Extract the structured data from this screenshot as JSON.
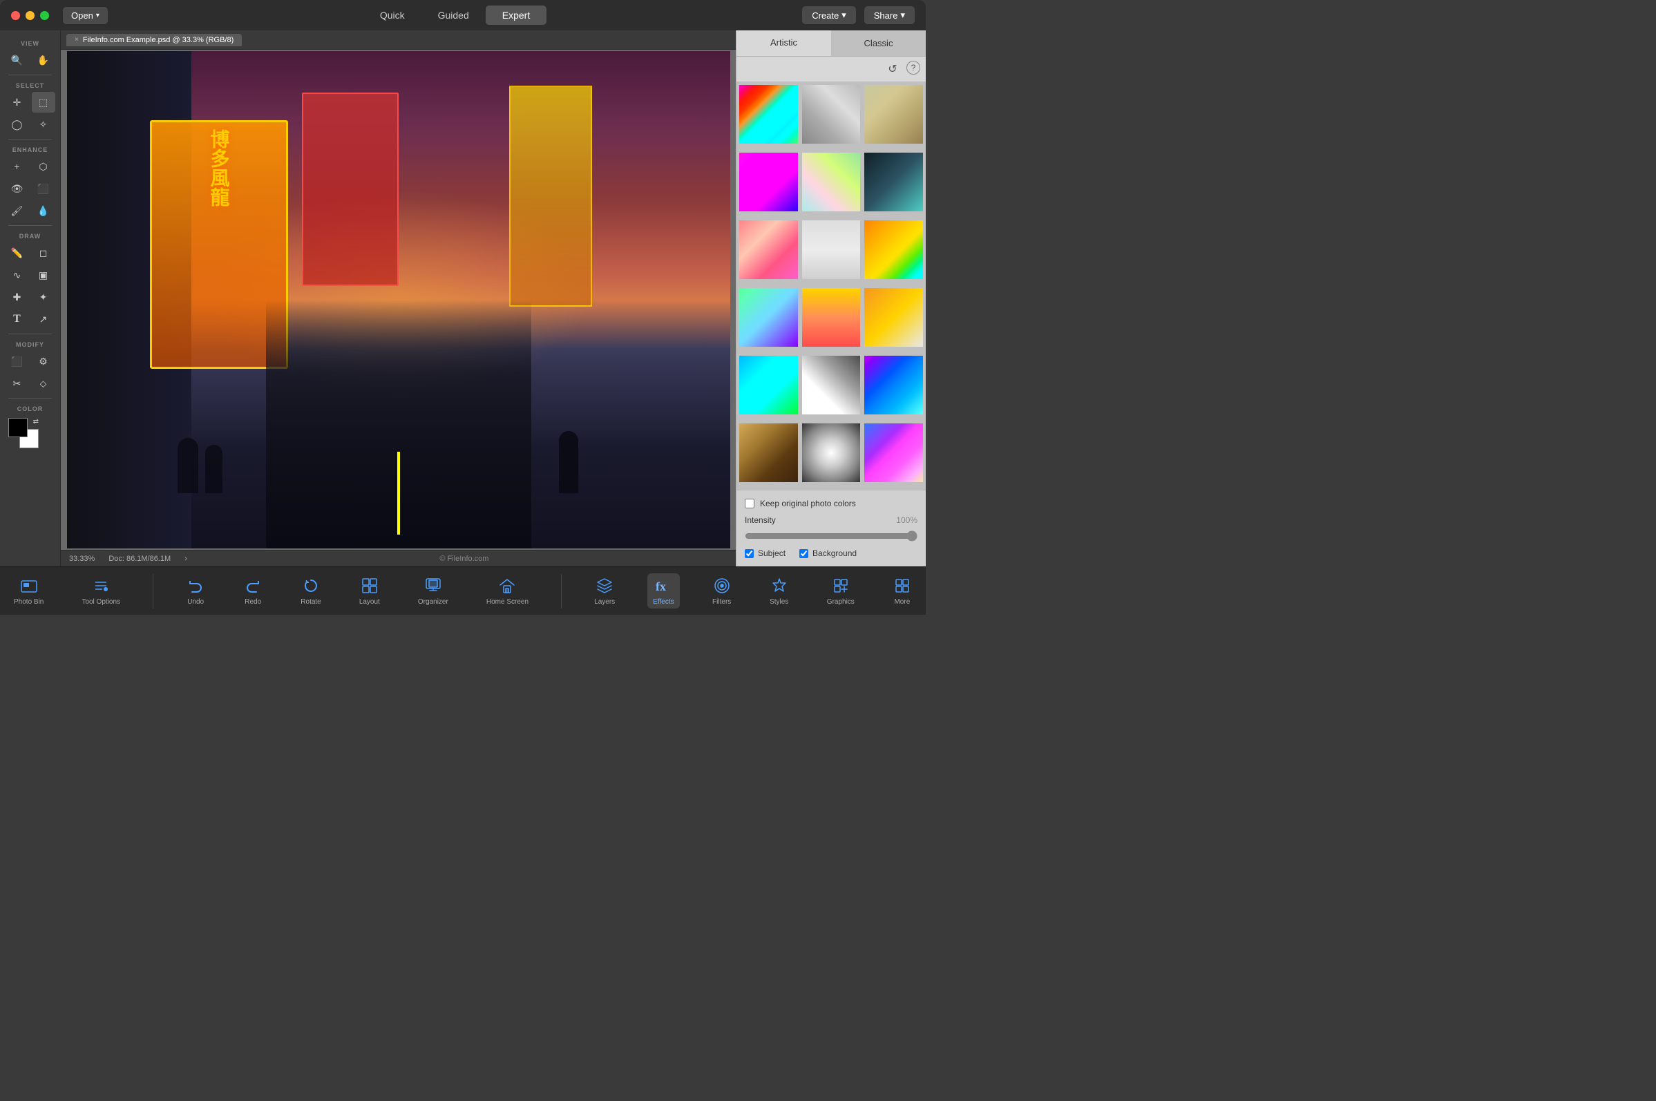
{
  "titlebar": {
    "mode_buttons": [
      {
        "id": "quick",
        "label": "Quick",
        "active": false
      },
      {
        "id": "guided",
        "label": "Guided",
        "active": false
      },
      {
        "id": "expert",
        "label": "Expert",
        "active": true
      }
    ],
    "open_label": "Open",
    "create_label": "Create",
    "share_label": "Share"
  },
  "tab": {
    "close_symbol": "×",
    "filename": "FileInfo.com Example.psd @ 33.3% (RGB/8)"
  },
  "status_bar": {
    "zoom": "33.33%",
    "doc_info": "Doc: 86.1M/86.1M",
    "expand": "›",
    "watermark": "© FileInfo.com"
  },
  "left_toolbar": {
    "sections": [
      {
        "label": "VIEW",
        "tools": [
          [
            {
              "id": "zoom",
              "icon": "🔍"
            },
            {
              "id": "hand",
              "icon": "✋"
            }
          ]
        ]
      },
      {
        "label": "SELECT",
        "tools": [
          [
            {
              "id": "move",
              "icon": "✛"
            },
            {
              "id": "marquee",
              "icon": "⬚",
              "active": true
            }
          ],
          [
            {
              "id": "lasso",
              "icon": "◯"
            },
            {
              "id": "quick-select",
              "icon": "✧"
            }
          ]
        ]
      },
      {
        "label": "ENHANCE",
        "tools": [
          [
            {
              "id": "crop",
              "icon": "+"
            },
            {
              "id": "healing",
              "icon": "🩹"
            }
          ],
          [
            {
              "id": "eye",
              "icon": "👁"
            },
            {
              "id": "clone",
              "icon": "🔲"
            }
          ],
          [
            {
              "id": "brush",
              "icon": "🖌"
            },
            {
              "id": "drop",
              "icon": "💧"
            }
          ]
        ]
      },
      {
        "label": "DRAW",
        "tools": [
          [
            {
              "id": "pen",
              "icon": "✏️"
            },
            {
              "id": "eraser",
              "icon": "◻"
            }
          ],
          [
            {
              "id": "smudge",
              "icon": "∿"
            },
            {
              "id": "gradient",
              "icon": "▣"
            }
          ],
          [
            {
              "id": "eyedropper",
              "icon": "✚"
            },
            {
              "id": "paint-bucket",
              "icon": "✦"
            }
          ],
          [
            {
              "id": "text",
              "icon": "T"
            },
            {
              "id": "blur",
              "icon": "↗"
            }
          ]
        ]
      },
      {
        "label": "MODIFY",
        "tools": [
          [
            {
              "id": "crop-tool",
              "icon": "⬛"
            },
            {
              "id": "settings",
              "icon": "⚙"
            }
          ],
          [
            {
              "id": "scissors",
              "icon": "✂"
            },
            {
              "id": "transform",
              "icon": "⬦"
            }
          ]
        ]
      },
      {
        "label": "COLOR",
        "tools": []
      }
    ]
  },
  "right_panel": {
    "tabs": [
      {
        "id": "artistic",
        "label": "Artistic",
        "active": true
      },
      {
        "id": "classic",
        "label": "Classic",
        "active": false
      }
    ],
    "toolbar_icons": [
      {
        "id": "refresh",
        "icon": "↺"
      },
      {
        "id": "help",
        "icon": "?"
      }
    ],
    "filters": [
      {
        "id": "f1",
        "class": "ft-1"
      },
      {
        "id": "f2",
        "class": "ft-2"
      },
      {
        "id": "f3",
        "class": "ft-3"
      },
      {
        "id": "f4",
        "class": "ft-4"
      },
      {
        "id": "f5",
        "class": "ft-5"
      },
      {
        "id": "f6",
        "class": "ft-6"
      },
      {
        "id": "f7",
        "class": "ft-7"
      },
      {
        "id": "f8",
        "class": "ft-8"
      },
      {
        "id": "f9",
        "class": "ft-9"
      },
      {
        "id": "f10",
        "class": "ft-10"
      },
      {
        "id": "f11",
        "class": "ft-11"
      },
      {
        "id": "f12",
        "class": "ft-12"
      },
      {
        "id": "f13",
        "class": "ft-13"
      },
      {
        "id": "f14",
        "class": "ft-14"
      },
      {
        "id": "f15",
        "class": "ft-15"
      },
      {
        "id": "f16",
        "class": "ft-16"
      },
      {
        "id": "f17",
        "class": "ft-17"
      },
      {
        "id": "f18",
        "class": "ft-18"
      }
    ],
    "keep_colors_label": "Keep original photo colors",
    "intensity_label": "Intensity",
    "intensity_value": "100%",
    "subject_label": "Subject",
    "background_label": "Background"
  },
  "bottom_bar": {
    "tools": [
      {
        "id": "photo-bin",
        "label": "Photo Bin",
        "icon": "🖼"
      },
      {
        "id": "tool-options",
        "label": "Tool Options",
        "icon": "✏"
      },
      {
        "id": "undo",
        "label": "Undo",
        "icon": "↩"
      },
      {
        "id": "redo",
        "label": "Redo",
        "icon": "↪"
      },
      {
        "id": "rotate",
        "label": "Rotate",
        "icon": "↻"
      },
      {
        "id": "layout",
        "label": "Layout",
        "icon": "⊞"
      },
      {
        "id": "organizer",
        "label": "Organizer",
        "icon": "⊟"
      },
      {
        "id": "home-screen",
        "label": "Home Screen",
        "icon": "⌂"
      },
      {
        "id": "layers",
        "label": "Layers",
        "icon": "◫"
      },
      {
        "id": "effects",
        "label": "Effects",
        "icon": "fx",
        "active": true
      },
      {
        "id": "filters",
        "label": "Filters",
        "icon": "◎"
      },
      {
        "id": "styles",
        "label": "Styles",
        "icon": "◈"
      },
      {
        "id": "graphics",
        "label": "Graphics",
        "icon": "◇"
      },
      {
        "id": "more",
        "label": "More",
        "icon": "⊕"
      }
    ]
  }
}
